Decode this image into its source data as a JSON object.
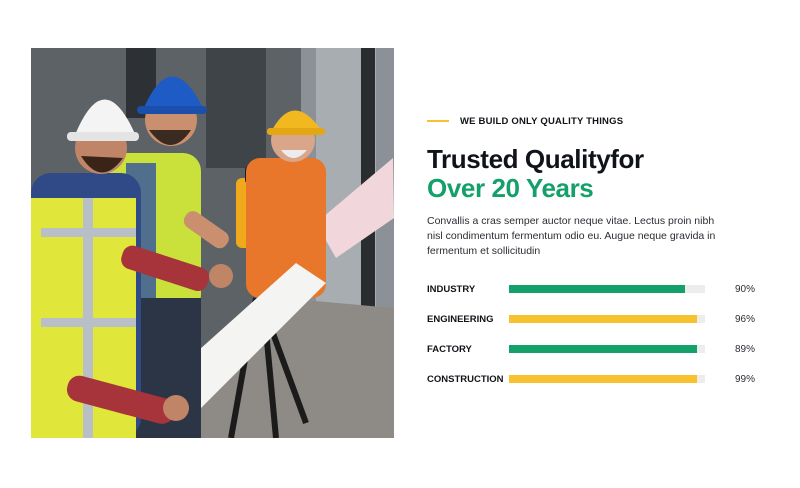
{
  "hero_image": {
    "alt": "Construction workers in hard hats reviewing blueprints on site"
  },
  "eyebrow": "WE BUILD ONLY QUALITY THINGS",
  "title_line1": "Trusted Qualityfor",
  "title_line2": "Over 20 Years",
  "description": "Convallis a cras semper auctor neque vitae. Lectus proin nibh nisl condimentum fermentum odio eu. Augue neque gravida in fermentum et sollicitudin",
  "colors": {
    "green": "#14a06b",
    "yellow": "#f7c22e",
    "track": "#ededed"
  },
  "skills": [
    {
      "label": "INDUSTRY",
      "percent_text": "90%",
      "fill_fraction": 0.9,
      "color": "#14a06b"
    },
    {
      "label": "ENGINEERING",
      "percent_text": "96%",
      "fill_fraction": 0.96,
      "color": "#f7c22e"
    },
    {
      "label": "FACTORY",
      "percent_text": "89%",
      "fill_fraction": 0.96,
      "color": "#14a06b"
    },
    {
      "label": "CONSTRUCTION",
      "percent_text": "99%",
      "fill_fraction": 0.96,
      "color": "#f7c22e"
    }
  ]
}
